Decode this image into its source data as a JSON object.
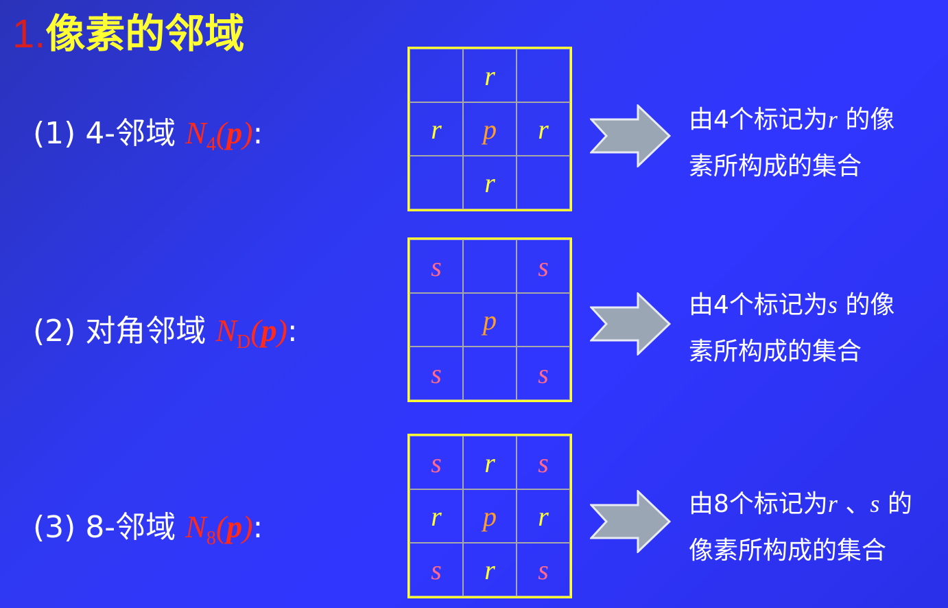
{
  "title": {
    "number": "1.",
    "text": "像素的邻域"
  },
  "sections": [
    {
      "label_prefix": "(1) 4-邻域 ",
      "symbol_letter": "N",
      "symbol_sub": "4",
      "symbol_open": "(",
      "symbol_arg": "p",
      "symbol_close": ")",
      "label_suffix": ":",
      "grid": [
        "",
        "r",
        "",
        "r",
        "p",
        "r",
        "",
        "r",
        ""
      ],
      "desc_line1_a": "由4个标记为",
      "desc_line1_var": "r",
      "desc_line1_b": " 的像",
      "desc_line2": "素所构成的集合"
    },
    {
      "label_prefix": "(2) 对角邻域 ",
      "symbol_letter": "N",
      "symbol_sub": "D",
      "symbol_open": "(",
      "symbol_arg": "p",
      "symbol_close": ")",
      "label_suffix": ":",
      "grid": [
        "s",
        "",
        "s",
        "",
        "p",
        "",
        "s",
        "",
        "s"
      ],
      "desc_line1_a": "由4个标记为",
      "desc_line1_var": "s",
      "desc_line1_b": " 的像",
      "desc_line2": "素所构成的集合"
    },
    {
      "label_prefix": "(3) 8-邻域 ",
      "symbol_letter": "N",
      "symbol_sub": "8",
      "symbol_open": "(",
      "symbol_arg": "p",
      "symbol_close": ")",
      "label_suffix": ":",
      "grid": [
        "s",
        "r",
        "s",
        "r",
        "p",
        "r",
        "s",
        "r",
        "s"
      ],
      "desc_line1_a": "由8个标记为",
      "desc_line1_var": "r",
      "desc_line1_sep": " 、",
      "desc_line1_var2": "s",
      "desc_line1_b": " 的",
      "desc_line2": "像素所构成的集合"
    }
  ],
  "icons": {
    "arrow": "right-arrow-icon"
  },
  "colors": {
    "title": "#ffff33",
    "number": "#d81e1e",
    "symbol": "#ff2a1a",
    "r": "#ffff33",
    "p": "#ff9e2a",
    "s": "#ff6a8a",
    "arrow": "#9aa6b4"
  }
}
